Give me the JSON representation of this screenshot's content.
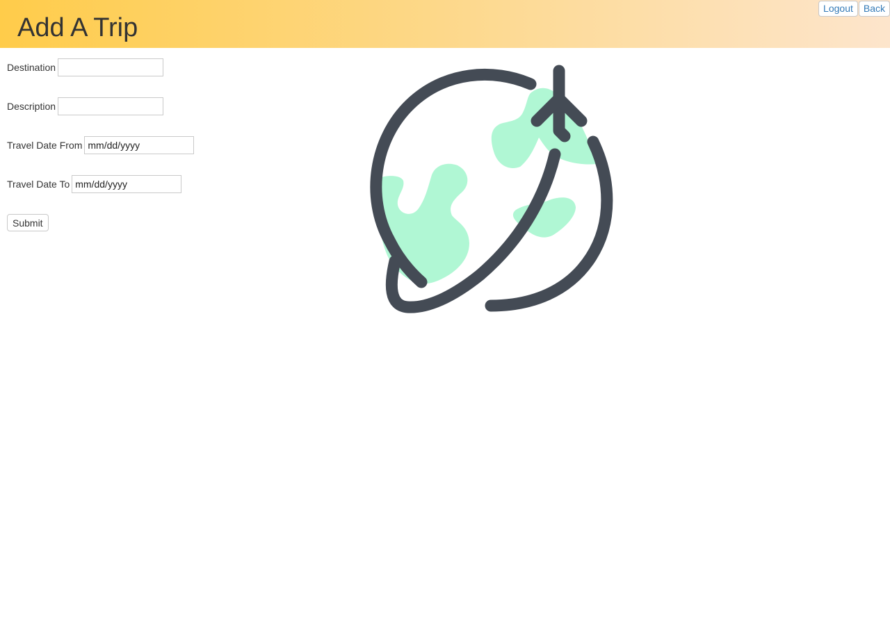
{
  "header": {
    "title": "Add A Trip",
    "logout_label": "Logout",
    "back_label": "Back"
  },
  "form": {
    "destination": {
      "label": "Destination",
      "value": "",
      "placeholder": ""
    },
    "description": {
      "label": "Description",
      "value": "",
      "placeholder": ""
    },
    "date_from": {
      "label": "Travel Date From",
      "value": "mm/dd/yyyy"
    },
    "date_to": {
      "label": "Travel Date To",
      "value": "mm/dd/yyyy"
    },
    "submit_label": "Submit"
  },
  "illustration": {
    "icon": "globe-airplane-icon",
    "stroke_color": "#444b55",
    "land_color": "#b0f7d4"
  },
  "colors": {
    "header_gradient_start": "#ffcc4a",
    "header_gradient_end": "#fde5cc",
    "link_color": "#337ab7"
  }
}
